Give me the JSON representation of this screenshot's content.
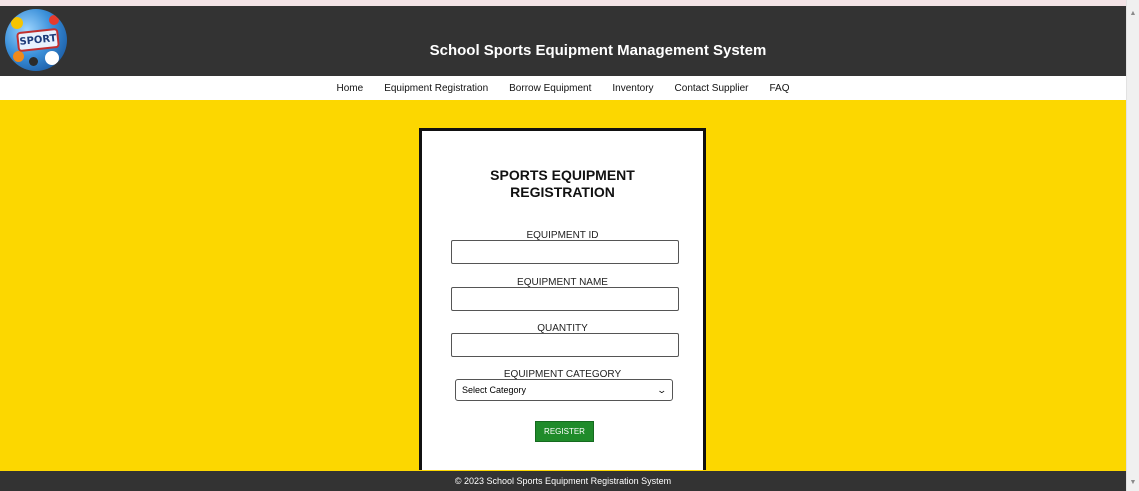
{
  "header": {
    "logo_text": "SPORT",
    "title": "School Sports Equipment Management System"
  },
  "nav": {
    "items": [
      "Home",
      "Equipment Registration",
      "Borrow Equipment",
      "Inventory",
      "Contact Supplier",
      "FAQ"
    ]
  },
  "form": {
    "title_line1": "SPORTS EQUIPMENT",
    "title_line2": "REGISTRATION",
    "equipment_id_label": "EQUIPMENT ID",
    "equipment_id_value": "",
    "equipment_name_label": "EQUIPMENT NAME",
    "equipment_name_value": "",
    "quantity_label": "QUANTITY",
    "quantity_value": "",
    "category_label": "EQUIPMENT CATEGORY",
    "category_selected": "Select Category",
    "register_label": "REGISTER"
  },
  "footer": {
    "text": "© 2023 School Sports Equipment Registration System"
  },
  "colors": {
    "header_bg": "#333333",
    "main_bg": "#fcd700",
    "button_bg": "#1f8b2a"
  }
}
